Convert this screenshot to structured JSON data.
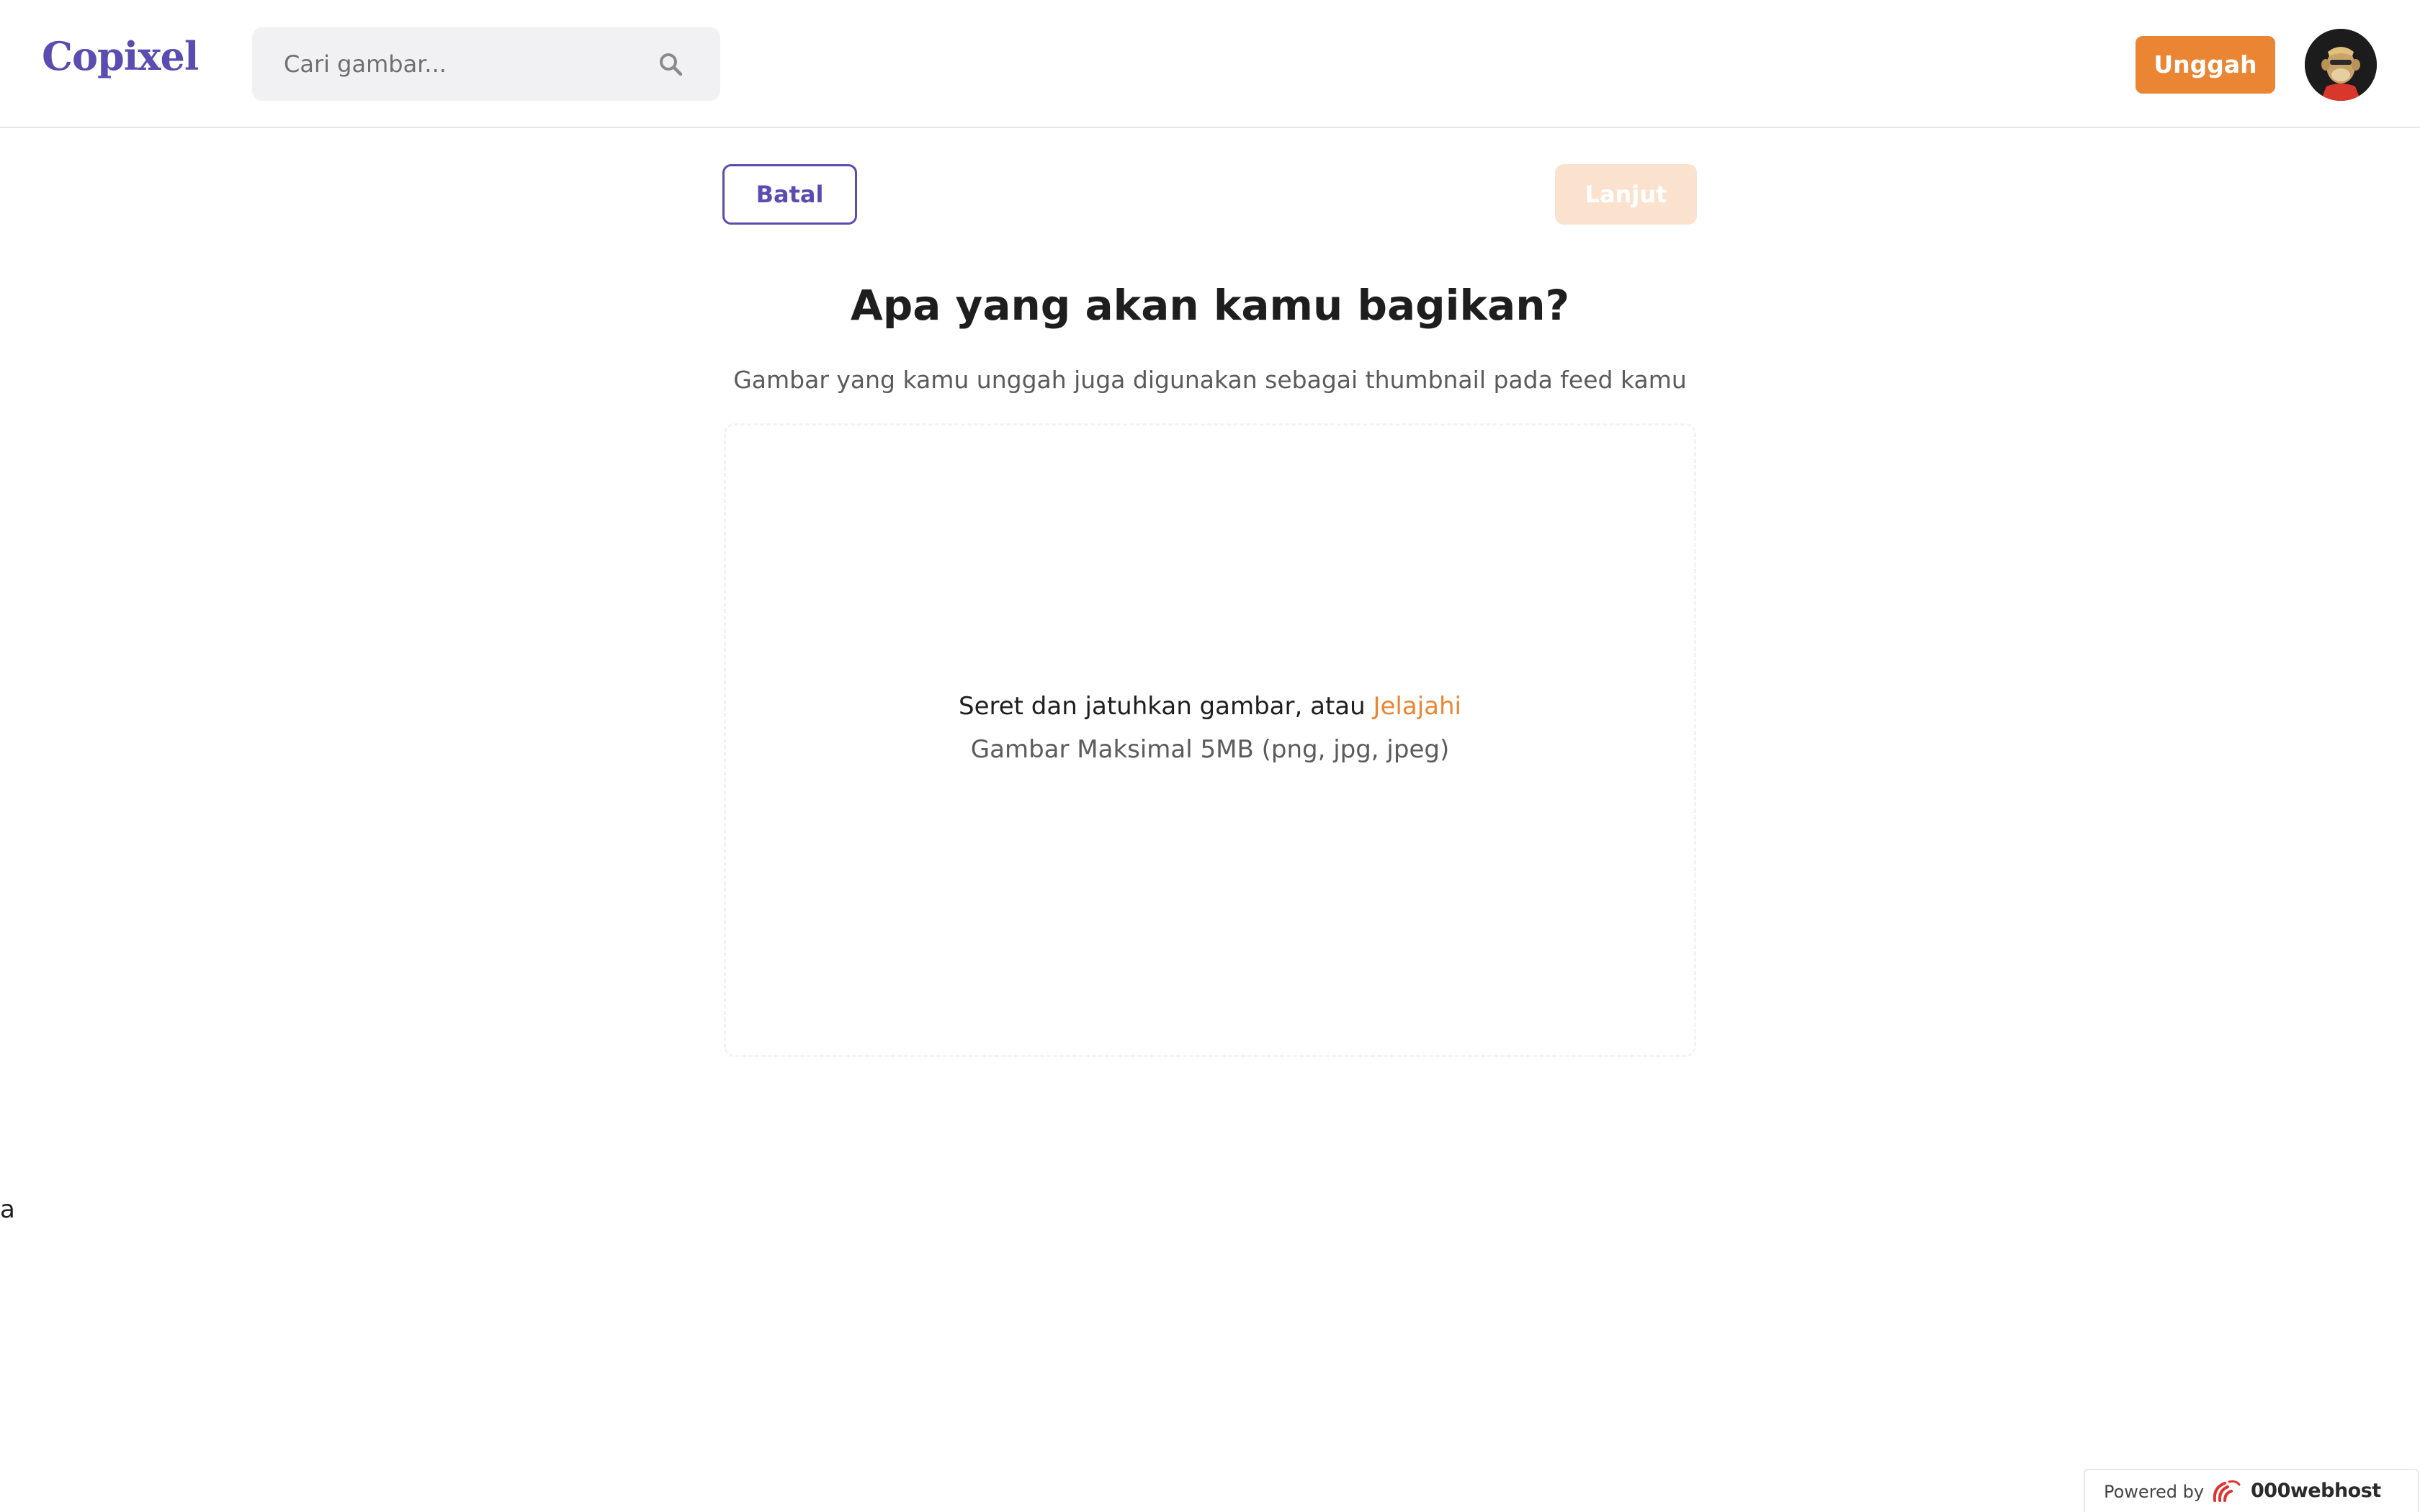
{
  "header": {
    "logo_text": "Copixel",
    "search": {
      "placeholder": "Cari gambar..."
    },
    "search_icon": "search-icon",
    "upload_label": "Unggah",
    "avatar_icon": "user-avatar"
  },
  "toolbar": {
    "cancel_label": "Batal",
    "next_label": "Lanjut"
  },
  "main": {
    "title": "Apa yang akan kamu bagikan?",
    "subtitle": "Gambar yang kamu unggah juga digunakan sebagai thumbnail pada feed kamu",
    "dropzone": {
      "line1_prefix": "Seret dan jatuhkan gambar, atau ",
      "browse_label": "Jelajahi",
      "line2": "Gambar Maksimal 5MB (png, jpg, jpeg)"
    },
    "stray_text": "a"
  },
  "footer": {
    "powered_by": "Powered by",
    "brand": "000webhost"
  },
  "colors": {
    "brand_purple": "#5a4cb0",
    "accent_orange": "#ea8633",
    "disabled_orange": "#fbe2cf"
  }
}
